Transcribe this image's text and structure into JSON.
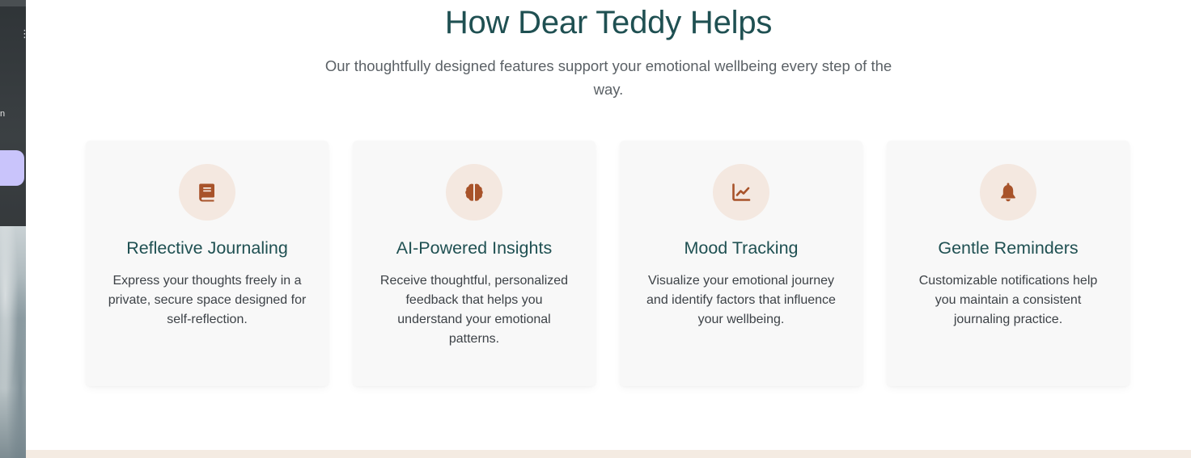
{
  "section": {
    "title": "How Dear Teddy Helps",
    "subtitle": "Our thoughtfully designed features support your emotional wellbeing every step of the way."
  },
  "features": [
    {
      "icon": "book-icon",
      "title": "Reflective Journaling",
      "description": "Express your thoughts freely in a private, secure space designed for self-reflection."
    },
    {
      "icon": "brain-icon",
      "title": "AI-Powered Insights",
      "description": "Receive thoughtful, personalized feedback that helps you understand your emotional patterns."
    },
    {
      "icon": "chart-line-icon",
      "title": "Mood Tracking",
      "description": "Visualize your emotional journey and identify factors that influence your wellbeing."
    },
    {
      "icon": "bell-icon",
      "title": "Gentle Reminders",
      "description": "Customizable notifications help you maintain a consistent journaling practice."
    }
  ],
  "colors": {
    "heading": "#1f5052",
    "icon_accent": "#a8532a",
    "icon_background": "#f4e8e0",
    "card_background": "#f8f8f8",
    "footer_band": "#f4ebe2"
  }
}
